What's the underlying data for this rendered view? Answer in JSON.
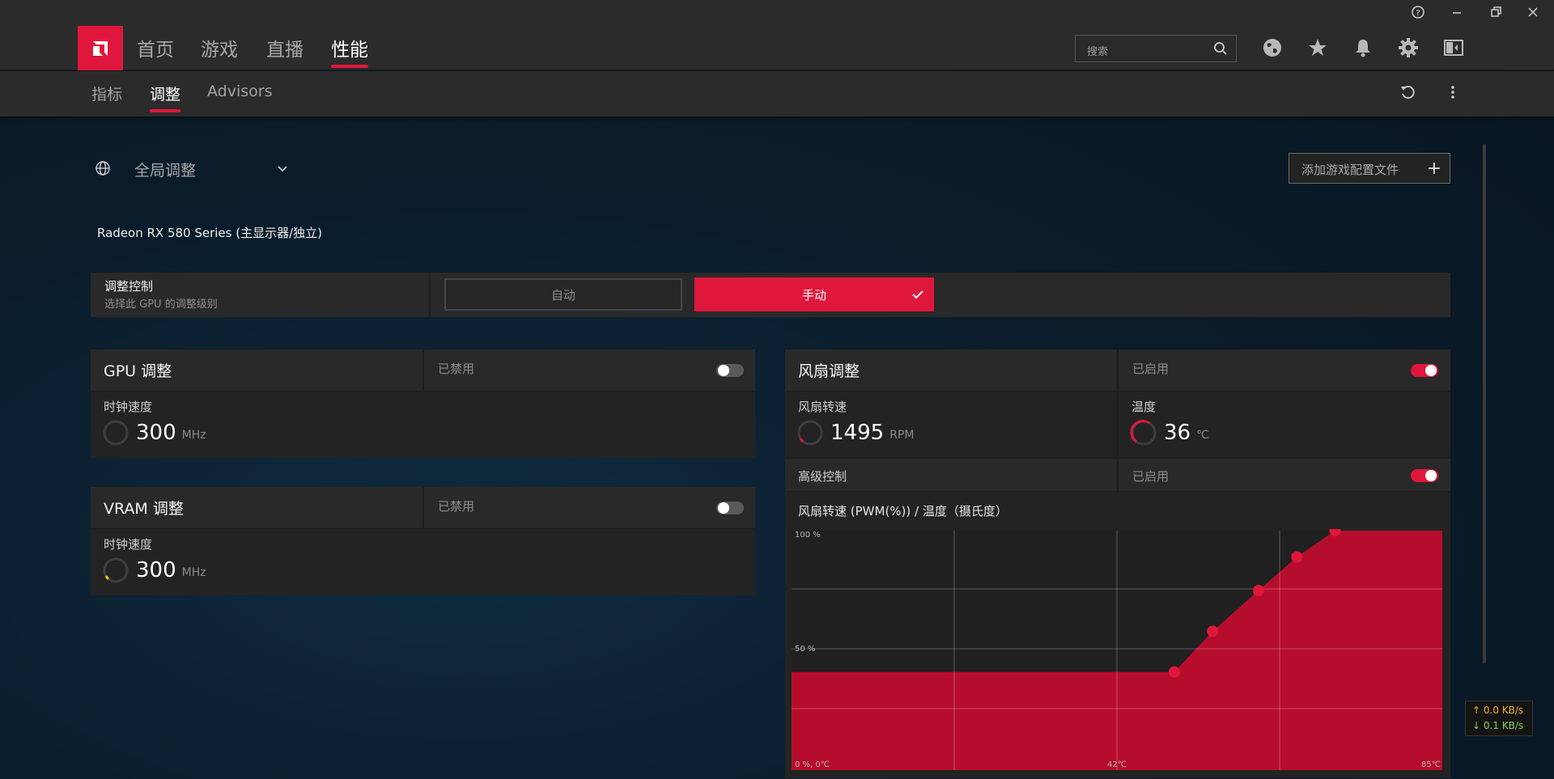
{
  "title_bar": {
    "help_icon": "help-icon",
    "minimize_icon": "minimize-icon",
    "restore_icon": "restore-icon",
    "close_icon": "close-icon"
  },
  "main_nav": {
    "items": [
      {
        "label": "首页"
      },
      {
        "label": "游戏"
      },
      {
        "label": "直播"
      },
      {
        "label": "性能",
        "active": true
      }
    ],
    "search_placeholder": "搜索",
    "icons": [
      "globe-icon",
      "star-icon",
      "bell-icon",
      "gear-icon",
      "sidebar-icon"
    ]
  },
  "sub_nav": {
    "items": [
      {
        "label": "指标"
      },
      {
        "label": "调整",
        "active": true
      },
      {
        "label": "Advisors"
      }
    ]
  },
  "scope": {
    "label": "全局调整"
  },
  "add_profile": {
    "label": "添加游戏配置文件",
    "plus": "+"
  },
  "gpu_name": "Radeon RX 580 Series (主显示器/独立)",
  "tuning_control": {
    "title": "调整控制",
    "subtitle": "选择此 GPU 的调整级别",
    "auto_label": "自动",
    "manual_label": "手动"
  },
  "gpu_tuning": {
    "title": "GPU 调整",
    "state": "已禁用",
    "enabled": false,
    "metric_label": "时钟速度",
    "value": "300",
    "unit": "MHz"
  },
  "vram_tuning": {
    "title": "VRAM 调整",
    "state": "已禁用",
    "enabled": false,
    "metric_label": "时钟速度",
    "value": "300",
    "unit": "MHz"
  },
  "fan_tuning": {
    "title": "风扇调整",
    "state": "已启用",
    "enabled": true,
    "fan_speed_label": "风扇转速",
    "fan_speed_value": "1495",
    "fan_speed_unit": "RPM",
    "temp_label": "温度",
    "temp_value": "36",
    "temp_unit": "℃",
    "advanced_label": "高级控制",
    "advanced_state": "已启用",
    "advanced_enabled": true
  },
  "chart_data": {
    "type": "area",
    "title": "风扇转速 (PWM(%)) / 温度（摄氏度）",
    "y_tick_labels": [
      "100 %",
      "50 %",
      "0 %, 0℃"
    ],
    "x_tick_labels": [
      "42℃",
      "85℃"
    ],
    "xlim": [
      0,
      85
    ],
    "ylim": [
      0,
      100
    ],
    "grid": true,
    "color": "#b70d2c",
    "point_color": "#e0173c",
    "points": [
      {
        "x": 50,
        "y": 41
      },
      {
        "x": 55,
        "y": 58
      },
      {
        "x": 61,
        "y": 75
      },
      {
        "x": 66,
        "y": 89
      },
      {
        "x": 71,
        "y": 100
      }
    ]
  },
  "net_monitor": {
    "up": "↑ 0.0 KB/s",
    "down": "↓ 0.1 KB/s"
  },
  "colors": {
    "accent": "#e0173c",
    "panel": "#232323",
    "header": "#2b2b2b"
  }
}
